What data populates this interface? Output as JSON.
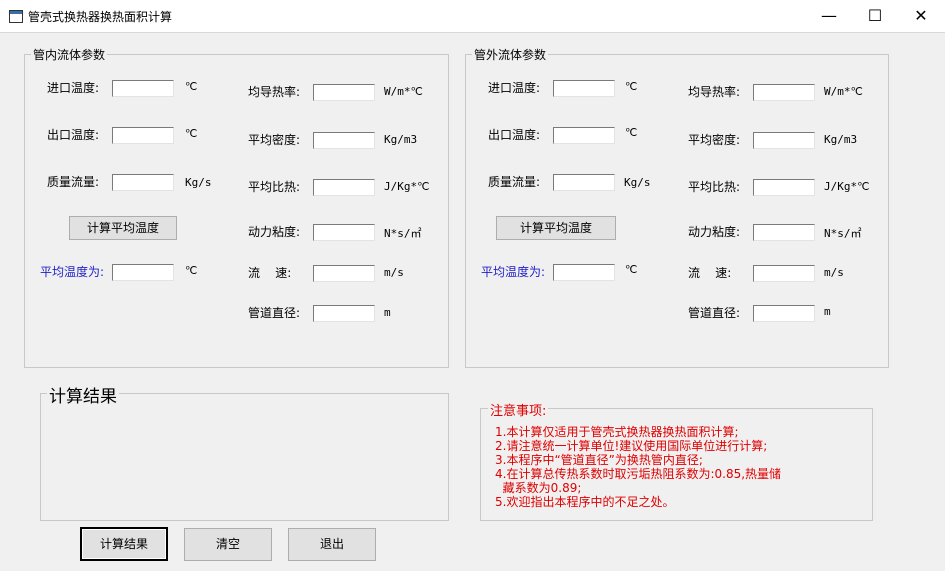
{
  "window": {
    "title": "管壳式换热器换热面积计算",
    "minimize": "—",
    "maximize": "☐",
    "close": "✕"
  },
  "inner": {
    "group_title": "管内流体参数",
    "inlet_temp": "进口温度:",
    "outlet_temp": "出口温度:",
    "mass_flow": "质量流量:",
    "calc_avg_btn": "计算平均温度",
    "avg_temp": "平均温度为:",
    "conductivity": "均导热率:",
    "density": "平均密度:",
    "specific_heat": "平均比热:",
    "viscosity": "动力粘度:",
    "velocity": "流    速:",
    "diameter": "管道直径:"
  },
  "outer": {
    "group_title": "管外流体参数",
    "inlet_temp": "进口温度:",
    "outlet_temp": "出口温度:",
    "mass_flow": "质量流量:",
    "calc_avg_btn": "计算平均温度",
    "avg_temp": "平均温度为:",
    "conductivity": "均导热率:",
    "density": "平均密度:",
    "specific_heat": "平均比热:",
    "viscosity": "动力粘度:",
    "velocity": "流    速:",
    "diameter": "管道直径:"
  },
  "units": {
    "celsius": "℃",
    "mass_flow": "Kg/s",
    "conductivity": "W/m*℃",
    "density": "Kg/m3",
    "specific_heat": "J/Kg*℃",
    "viscosity": "N*s/㎡",
    "velocity": "m/s",
    "diameter": "m"
  },
  "result": {
    "title": "计算结果"
  },
  "notice": {
    "title": "注意事项:",
    "lines": [
      "1.本计算仅适用于管壳式换热器换热面积计算;",
      "2.请注意统一计算单位!建议使用国际单位进行计算;",
      "3.本程序中“管道直径”为换热管内直径;",
      "4.在计算总传热系数时取污垢热阻系数为:0.85,热量储",
      "  藏系数为0.89;",
      "5.欢迎指出本程序中的不足之处。"
    ]
  },
  "buttons": {
    "calculate": "计算结果",
    "clear": "清空",
    "exit": "退出"
  },
  "colors": {
    "notice_text": "#e00000",
    "avg_label": "#1e1ec8",
    "background": "#f0f0f0"
  }
}
